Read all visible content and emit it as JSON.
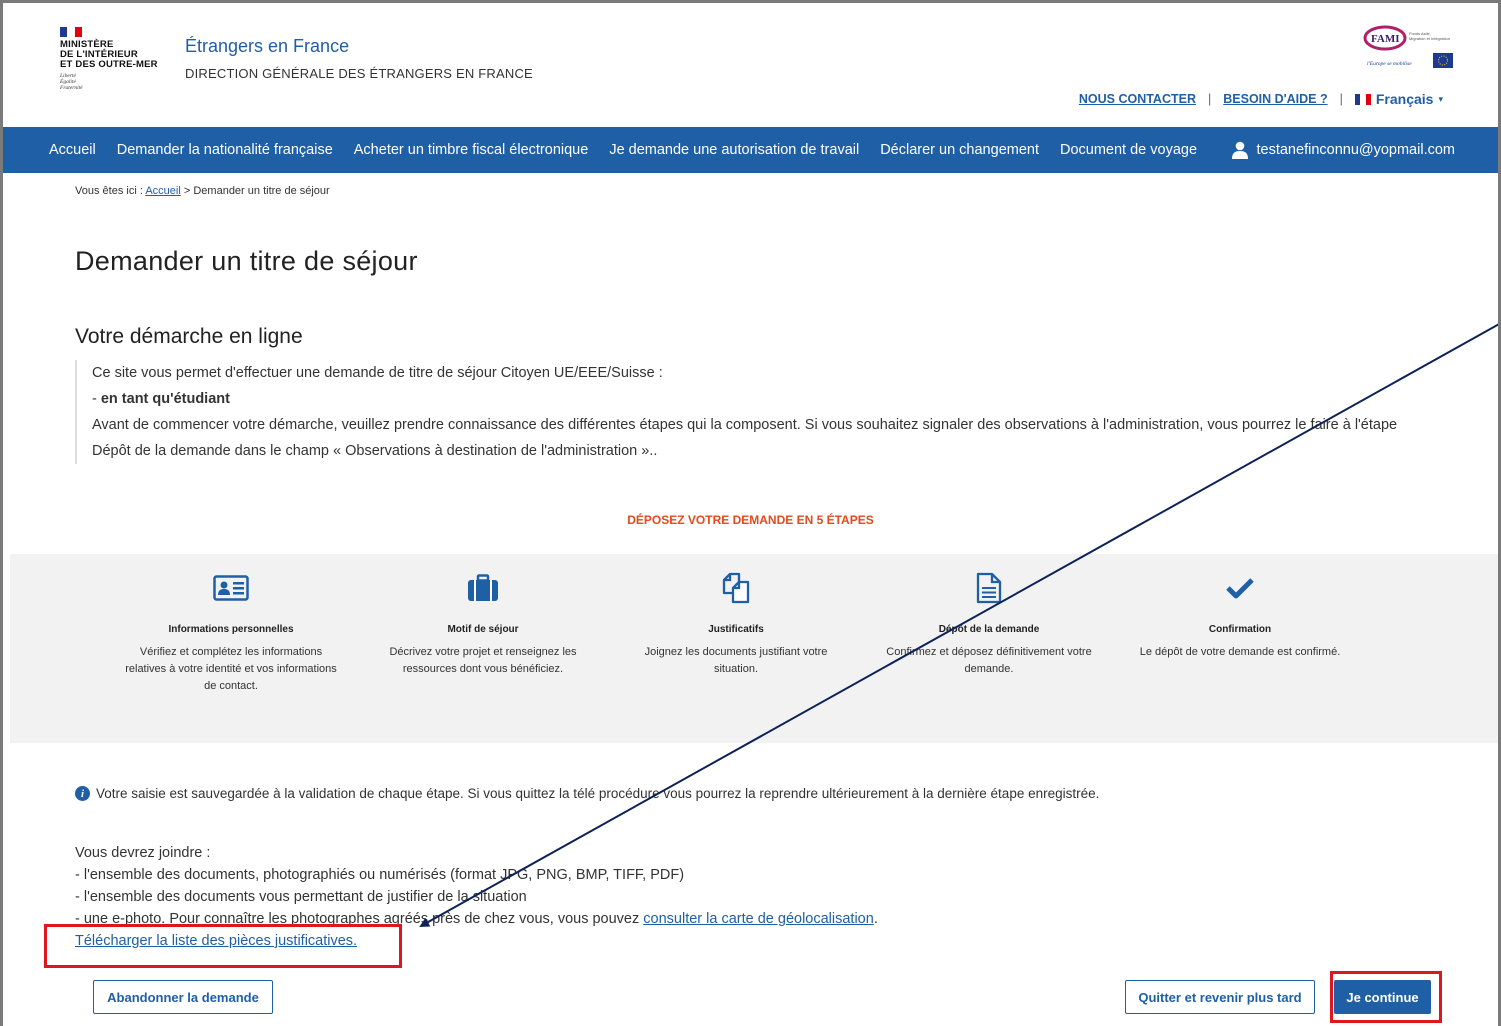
{
  "header": {
    "ministry_lines": [
      "MINISTÈRE",
      "DE L'INTÉRIEUR",
      "ET DES OUTRE-MER"
    ],
    "motto_lines": [
      "Liberté",
      "Égalité",
      "Fraternité"
    ],
    "site_title": "Étrangers en France",
    "site_subtitle": "DIRECTION GÉNÉRALE DES ÉTRANGERS EN FRANCE",
    "fami_label": "FAMI",
    "fami_sub": "Fonds Asile, Migration et Intégration",
    "fami_slogan": "l'Europe se mobilise",
    "links": {
      "contact": "NOUS CONTACTER",
      "help": "BESOIN D'AIDE ?",
      "separator": "|",
      "language": "Français"
    }
  },
  "nav": {
    "items": [
      "Accueil",
      "Demander la nationalité française",
      "Acheter un timbre fiscal électronique",
      "Je demande une autorisation de travail",
      "Déclarer un changement",
      "Document de voyage"
    ],
    "user_email": "testanefinconnu@yopmail.com"
  },
  "breadcrumb": {
    "prefix": "Vous êtes ici :",
    "home": "Accueil",
    "separator": ">",
    "current": "Demander un titre de séjour"
  },
  "page_title": "Demander un titre de séjour",
  "section_title": "Votre démarche en ligne",
  "intro": {
    "line1": "Ce site vous permet d'effectuer une demande de titre de séjour Citoyen UE/EEE/Suisse :",
    "line2_prefix": "- ",
    "line2_bold": "en tant qu'étudiant",
    "line3": "Avant de commencer votre démarche, veuillez prendre connaissance des différentes étapes qui la composent. Si vous souhaitez signaler des observations à l'administration, vous pourrez le faire à l'étape Dépôt de la demande dans le champ « Observations à destination de l'administration ».."
  },
  "steps_heading": "DÉPOSEZ VOTRE DEMANDE EN 5 ÉTAPES",
  "steps": [
    {
      "icon": "id-card-icon",
      "title": "Informations personnelles",
      "desc": "Vérifiez et complétez les informations relatives à votre identité et vos informations de contact."
    },
    {
      "icon": "suitcase-icon",
      "title": "Motif de séjour",
      "desc": "Décrivez votre projet et renseignez les ressources dont vous bénéficiez."
    },
    {
      "icon": "copy-files-icon",
      "title": "Justificatifs",
      "desc": "Joignez les documents justifiant votre situation."
    },
    {
      "icon": "document-icon",
      "title": "Dépôt de la demande",
      "desc": "Confirmez et déposez définitivement votre demande."
    },
    {
      "icon": "checkmark-icon",
      "title": "Confirmation",
      "desc": "Le dépôt de votre demande est confirmé."
    }
  ],
  "info_text": "Votre saisie est sauvegardée à la validation de chaque étape. Si vous quittez la télé procédure vous pourrez la reprendre ultérieurement à la dernière étape enregistrée.",
  "docs": {
    "intro": "Vous devrez joindre :",
    "item1": "- l'ensemble des documents, photographiés ou numérisés (format JPG, PNG, BMP, TIFF, PDF)",
    "item2": "- l'ensemble des documents vous permettant de justifier de la situation",
    "item3_prefix": "- une e-photo. Pour connaître les photographes agréés près de chez vous, vous pouvez ",
    "item3_link": "consulter la carte de géolocalisation",
    "item3_suffix": ".",
    "download_link": "Télécharger la liste des pièces justificatives."
  },
  "buttons": {
    "abandon": "Abandonner la demande",
    "quit": "Quitter et revenir plus tard",
    "continue": "Je continue"
  },
  "colors": {
    "brand_blue": "#1f5fa6",
    "steps_heading": "#e24b1a",
    "annotation_red": "#e0161e",
    "annotation_arrow": "#0d2357"
  }
}
